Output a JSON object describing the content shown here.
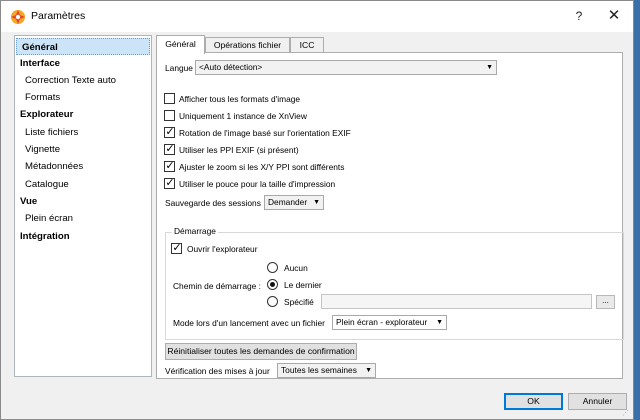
{
  "window": {
    "title": "Paramètres",
    "help_label": "?",
    "close_label": "✕",
    "icon": "xnview-app-icon"
  },
  "sidebar": {
    "items": [
      {
        "label": "Général",
        "kind": "category",
        "selected": true
      },
      {
        "label": "Interface",
        "kind": "category"
      },
      {
        "label": "Correction Texte auto",
        "kind": "sub"
      },
      {
        "label": "Formats",
        "kind": "sub"
      },
      {
        "label": "Explorateur",
        "kind": "category"
      },
      {
        "label": "Liste fichiers",
        "kind": "sub"
      },
      {
        "label": "Vignette",
        "kind": "sub"
      },
      {
        "label": "Métadonnées",
        "kind": "sub"
      },
      {
        "label": "Catalogue",
        "kind": "sub"
      },
      {
        "label": "Vue",
        "kind": "category"
      },
      {
        "label": "Plein écran",
        "kind": "sub"
      },
      {
        "label": "Intégration",
        "kind": "category"
      }
    ]
  },
  "tabs": [
    {
      "label": "Général",
      "active": true
    },
    {
      "label": "Opérations fichier"
    },
    {
      "label": "ICC"
    }
  ],
  "general": {
    "language_label": "Langue",
    "language_value": "<Auto détection>",
    "checkboxes": [
      {
        "label": "Afficher tous les formats d'image",
        "checked": false
      },
      {
        "label": "Uniquement 1 instance de XnView",
        "checked": false
      },
      {
        "label": "Rotation de l'image basé sur l'orientation EXIF",
        "checked": true
      },
      {
        "label": "Utiliser les PPI EXIF (si présent)",
        "checked": true
      },
      {
        "label": "Ajuster le zoom si les X/Y PPI sont différents",
        "checked": true
      },
      {
        "label": "Utiliser le pouce pour la taille d'impression",
        "checked": true
      }
    ],
    "session_label": "Sauvegarde des sessions",
    "session_value": "Demander",
    "startup": {
      "group_title": "Démarrage",
      "open_browser_label": "Ouvrir l'explorateur",
      "open_browser_checked": true,
      "path_label": "Chemin de démarrage :",
      "radios": [
        {
          "label": "Aucun",
          "selected": false
        },
        {
          "label": "Le dernier",
          "selected": true
        },
        {
          "label": "Spécifié",
          "selected": false
        }
      ],
      "specified_path_value": "",
      "browse_label": "...",
      "launch_mode_label": "Mode lors d'un lancement avec un fichier",
      "launch_mode_value": "Plein écran - explorateur"
    },
    "reset_button_label": "Réinitialiser toutes les demandes de confirmation",
    "update_label": "Vérification des mises à jour",
    "update_value": "Toutes les semaines"
  },
  "footer": {
    "ok_label": "OK",
    "cancel_label": "Annuler"
  },
  "colors": {
    "selection": "#cce4f7",
    "default_button_border": "#0078d7",
    "dialog_bg": "#f0f0f0"
  }
}
